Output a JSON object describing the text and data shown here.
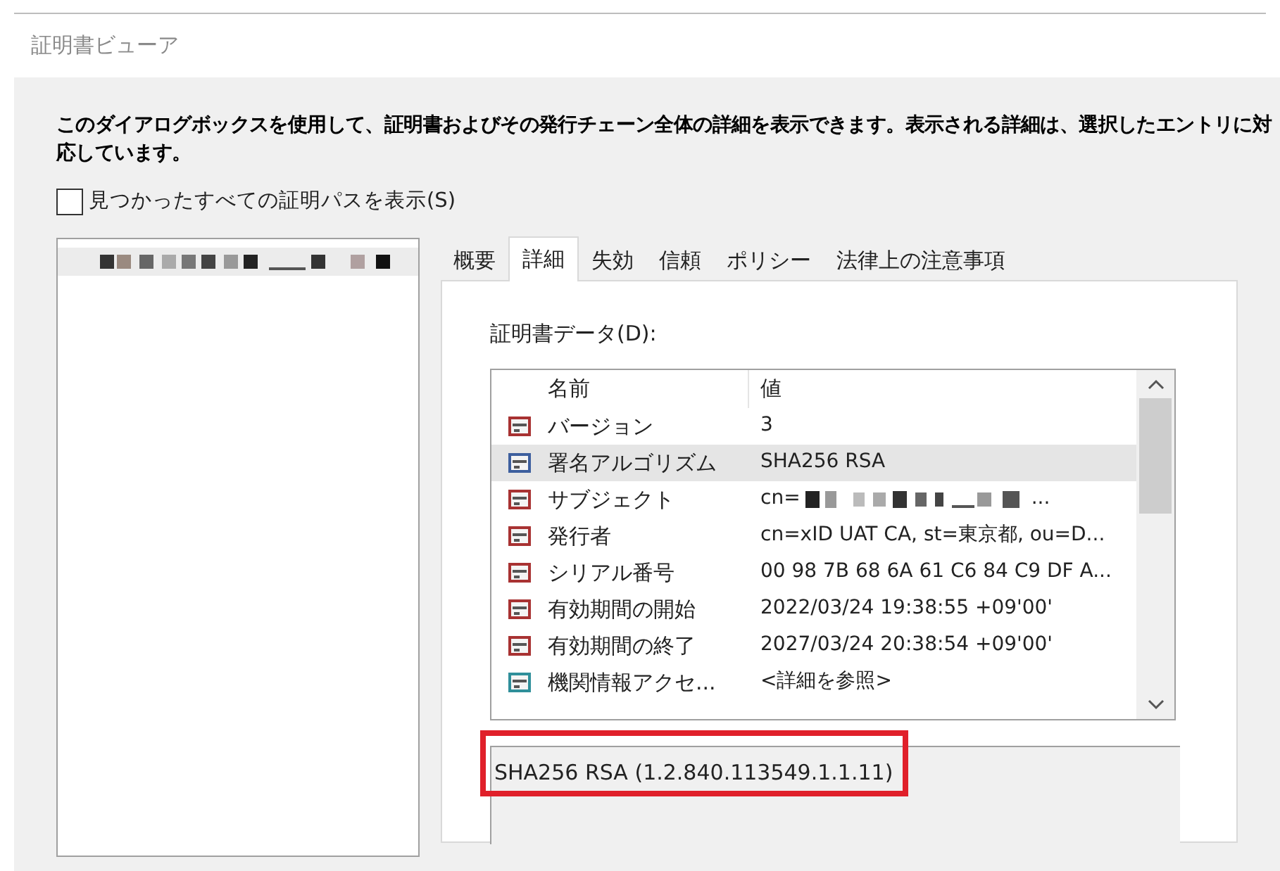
{
  "window": {
    "title": "証明書ビューア"
  },
  "description": "このダイアログボックスを使用して、証明書およびその発行チェーン全体の詳細を表示できます。表示される詳細は、選択したエントリに対応しています。",
  "show_all_paths": {
    "label": "見つかったすべての証明パスを表示(S)",
    "checked": false
  },
  "tree": {
    "items": [
      {
        "kind": "redacted",
        "selected": true
      }
    ]
  },
  "tabs": [
    {
      "label": "概要",
      "selected": false
    },
    {
      "label": "詳細",
      "selected": true
    },
    {
      "label": "失効",
      "selected": false
    },
    {
      "label": "信頼",
      "selected": false
    },
    {
      "label": "ポリシー",
      "selected": false
    },
    {
      "label": "法律上の注意事項",
      "selected": false
    }
  ],
  "cert_data": {
    "label": "証明書データ(D):",
    "columns": [
      "名前",
      "値"
    ],
    "rows": [
      {
        "name": "バージョン",
        "value": "3",
        "color": "#a83232",
        "selected": false
      },
      {
        "name": "署名アルゴリズム",
        "value": "SHA256 RSA",
        "color": "#3d5f9e",
        "selected": true
      },
      {
        "name": "サブジェクト",
        "value": "cn=",
        "redacted": true,
        "value_end": "...",
        "color": "#a83232",
        "selected": false
      },
      {
        "name": "発行者",
        "value": "cn=xID UAT CA, st=東京都, ou=D...",
        "color": "#a83232",
        "selected": false
      },
      {
        "name": "シリアル番号",
        "value": "00 98 7B 68 6A 61 C6 84 C9 DF A...",
        "color": "#a83232",
        "selected": false
      },
      {
        "name": "有効期間の開始",
        "value": "2022/03/24 19:38:55 +09'00'",
        "color": "#a83232",
        "selected": false
      },
      {
        "name": "有効期間の終了",
        "value": "2027/03/24 20:38:54 +09'00'",
        "color": "#a83232",
        "selected": false
      },
      {
        "name": "機関情報アクセ...",
        "value": "<詳細を参照>",
        "color": "#2f8f9a",
        "selected": false
      }
    ]
  },
  "detail": {
    "value": "SHA256 RSA (1.2.840.113549.1.1.11)",
    "highlighted": true
  }
}
